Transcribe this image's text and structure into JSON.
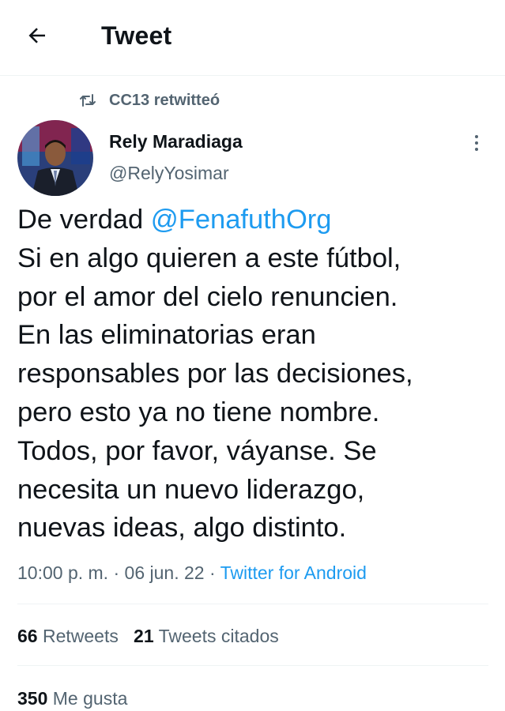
{
  "header": {
    "title": "Tweet",
    "back_icon": "arrow-left-icon"
  },
  "retweet_note": {
    "icon": "retweet-icon",
    "text": "CC13 retwitteó"
  },
  "author": {
    "name": "Rely Maradiaga",
    "handle": "@RelyYosimar",
    "avatar": "avatar-photo"
  },
  "tweet": {
    "line1_prefix": "De verdad ",
    "mention": "@FenafuthOrg",
    "body": "Si en algo quieren a este fútbol,\npor el amor del cielo renuncien.\nEn las eliminatorias eran\nresponsables por las decisiones,\npero esto ya no tiene nombre.\nTodos, por favor, váyanse. Se\nnecesita un nuevo liderazgo,\nnuevas ideas, algo distinto."
  },
  "meta": {
    "time": "10:00 p. m.",
    "sep1": " · ",
    "date": "06 jun. 22",
    "sep2": " · ",
    "source": "Twitter for Android"
  },
  "stats": {
    "retweets_count": "66",
    "retweets_label": "Retweets",
    "quotes_count": "21",
    "quotes_label": "Tweets citados",
    "likes_count": "350",
    "likes_label": "Me gusta"
  },
  "colors": {
    "link": "#1d9bf0",
    "secondary": "#536471",
    "text": "#0f1419",
    "divider": "#eff3f4"
  }
}
